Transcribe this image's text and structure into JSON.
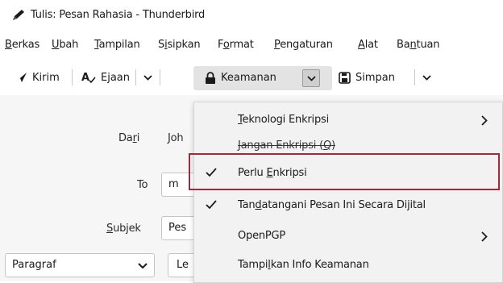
{
  "window": {
    "title": "Tulis: Pesan Rahasia - Thunderbird",
    "title_icon": "pencil-icon"
  },
  "menubar": {
    "items": [
      {
        "pre": "",
        "ul": "B",
        "post": "erkas"
      },
      {
        "pre": "",
        "ul": "U",
        "post": "bah"
      },
      {
        "pre": "",
        "ul": "T",
        "post": "ampilan"
      },
      {
        "pre": "S",
        "ul": "i",
        "post": "sipkan"
      },
      {
        "pre": "F",
        "ul": "o",
        "post": "rmat"
      },
      {
        "pre": "",
        "ul": "P",
        "post": "engaturan"
      },
      {
        "pre": "",
        "ul": "A",
        "post": "lat"
      },
      {
        "pre": "Ba",
        "ul": "n",
        "post": "tuan"
      }
    ]
  },
  "toolbar": {
    "send_label": "Kirim",
    "spelling_label": "Ejaan",
    "security_label": "Keamanan",
    "save_label": "Simpan"
  },
  "compose": {
    "from_label_pre": "Da",
    "from_label_ul": "r",
    "from_label_post": "i",
    "from_value": "Joh",
    "to_label": "To",
    "to_value": "m",
    "subject_label_pre": "",
    "subject_label_ul": "S",
    "subject_label_post": "ubjek",
    "subject_value": "Pes",
    "paragraph_select": "Paragraf",
    "second_select": "Le"
  },
  "security_menu": {
    "items": [
      {
        "pre": "",
        "ul": "T",
        "post": "eknologi Enkripsi",
        "checked": false,
        "submenu": true,
        "strike": false
      },
      {
        "pre": "Jangan Enkripsi (",
        "ul": "Q",
        "post": ")",
        "checked": false,
        "submenu": false,
        "strike": true
      },
      {
        "pre": "Perlu ",
        "ul": "E",
        "post": "nkripsi",
        "checked": true,
        "submenu": false,
        "strike": false
      },
      {
        "pre": "Tan",
        "ul": "d",
        "post": "atangani Pesan Ini Secara Dijital",
        "checked": true,
        "submenu": false,
        "strike": false
      },
      {
        "pre": "OpenPGP",
        "ul": "",
        "post": "",
        "checked": false,
        "submenu": true,
        "strike": false
      },
      {
        "pre": "Tampi",
        "ul": "l",
        "post": "kan Info Keamanan",
        "checked": false,
        "submenu": false,
        "strike": false
      }
    ]
  },
  "colors": {
    "highlight_border": "#a8263b"
  }
}
